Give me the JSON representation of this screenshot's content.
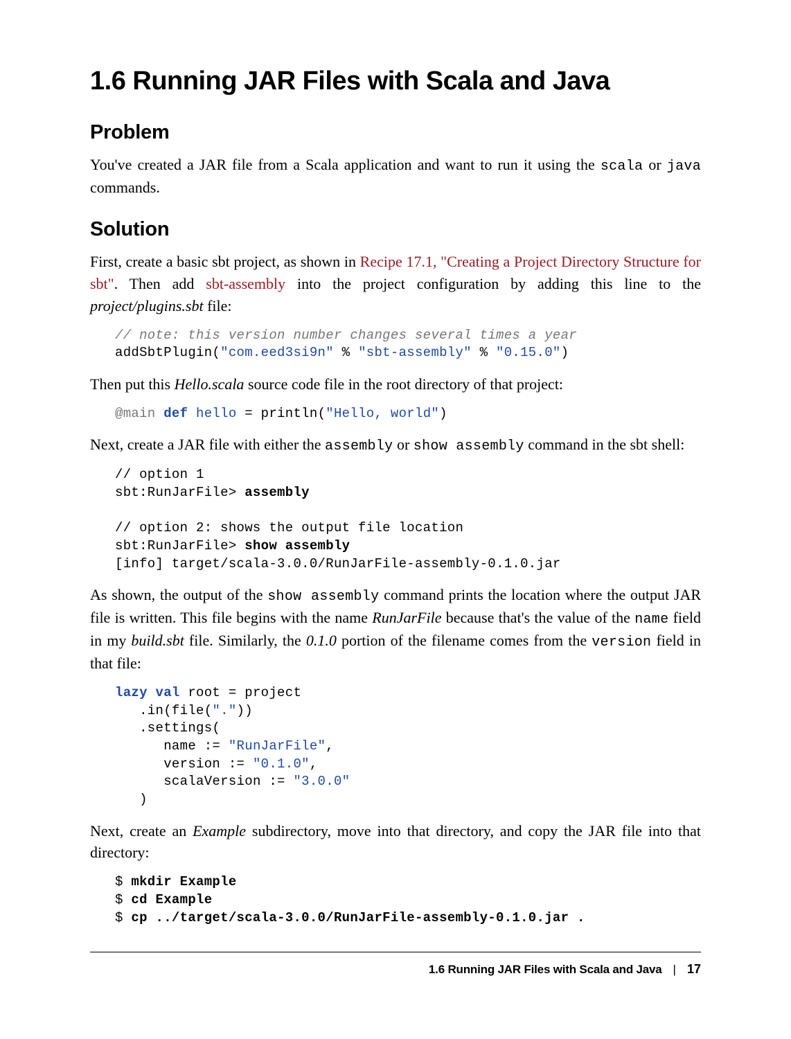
{
  "heading": "1.6 Running JAR Files with Scala and Java",
  "problem": {
    "title": "Problem",
    "text_parts": {
      "p1_a": "You've created a JAR file from a Scala application and want to run it using the ",
      "p1_code1": "scala",
      "p1_b": " or ",
      "p1_code2": "java",
      "p1_c": " commands."
    }
  },
  "solution": {
    "title": "Solution",
    "p1": {
      "a": "First, create a basic sbt project, as shown in ",
      "link1": "Recipe 17.1, \"Creating a Project Directory Structure for sbt\"",
      "b": ". Then add ",
      "link2": "sbt-assembly",
      "c": " into the project configuration by adding this line to the ",
      "file": "project/plugins.sbt",
      "d": " file:"
    },
    "code1": {
      "comment": "// note: this version number changes several times a year",
      "line2_a": "addSbtPlugin(",
      "line2_s1": "\"com.eed3si9n\"",
      "line2_b": " % ",
      "line2_s2": "\"sbt-assembly\"",
      "line2_c": " % ",
      "line2_s3": "\"0.15.0\"",
      "line2_d": ")"
    },
    "p2": {
      "a": "Then put this ",
      "file": "Hello.scala",
      "b": " source code file in the root directory of that project:"
    },
    "code2": {
      "ann": "@main",
      "sp1": " ",
      "kw": "def",
      "sp2": " ",
      "name": "hello",
      "eq": " = println(",
      "str": "\"Hello, world\"",
      "end": ")"
    },
    "p3": {
      "a": "Next, create a JAR file with either the ",
      "code1": "assembly",
      "b": " or ",
      "code2": "show assembly",
      "c": " command in the sbt shell:"
    },
    "code3": {
      "l1": "// option 1",
      "l2a": "sbt:RunJarFile> ",
      "l2b": "assembly",
      "blank": "",
      "l3": "// option 2: shows the output file location",
      "l4a": "sbt:RunJarFile> ",
      "l4b": "show assembly",
      "l5": "[info] target/scala-3.0.0/RunJarFile-assembly-0.1.0.jar"
    },
    "p4": {
      "a": "As shown, the output of the ",
      "code1": "show assembly",
      "b": " command prints the location where the output JAR file is written. This file begins with the name ",
      "it1": "RunJarFile",
      "c": " because that's the value of the ",
      "code2": "name",
      "d": " field in my ",
      "it2": "build.sbt",
      "e": " file. Similarly, the ",
      "it3": "0.1.0",
      "f": " portion of the filename comes from the ",
      "code3": "version",
      "g": " field in that file:"
    },
    "code4": {
      "l1a": "lazy val",
      "l1b": " root = project",
      "l2a": "   .in(file(",
      "l2b": "\".\"",
      "l2c": "))",
      "l3": "   .settings(",
      "l4a": "      name := ",
      "l4b": "\"RunJarFile\"",
      "l4c": ",",
      "l5a": "      version := ",
      "l5b": "\"0.1.0\"",
      "l5c": ",",
      "l6a": "      scalaVersion := ",
      "l6b": "\"3.0.0\"",
      "l7": "   )"
    },
    "p5": {
      "a": "Next, create an ",
      "it": "Example",
      "b": " subdirectory, move into that directory, and copy the JAR file into that directory:"
    },
    "code5": {
      "l1a": "$ ",
      "l1b": "mkdir Example",
      "l2a": "$ ",
      "l2b": "cd Example",
      "l3a": "$ ",
      "l3b": "cp ../target/scala-3.0.0/RunJarFile-assembly-0.1.0.jar ."
    }
  },
  "footer": {
    "title": "1.6 Running JAR Files with Scala and Java",
    "sep": "|",
    "page": "17"
  }
}
